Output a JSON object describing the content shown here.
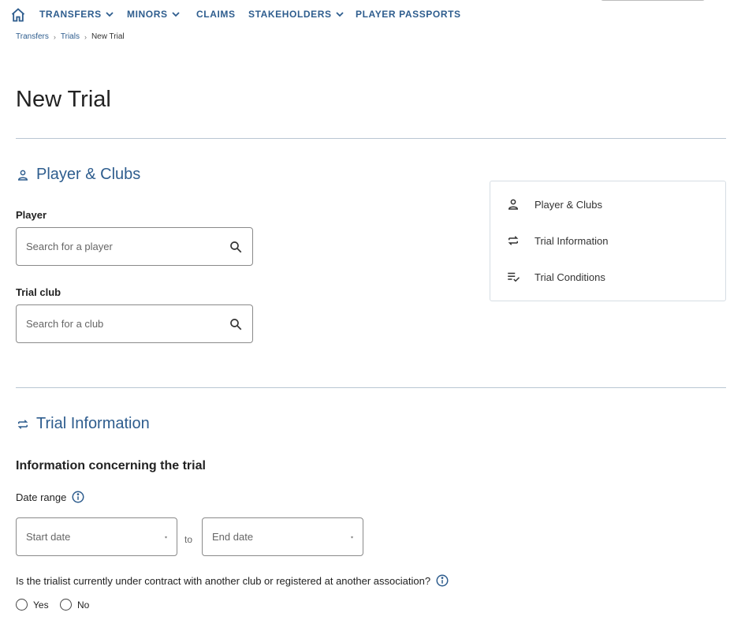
{
  "nav": {
    "items": [
      {
        "label": "TRANSFERS",
        "dropdown": true
      },
      {
        "label": "MINORS",
        "dropdown": true
      },
      {
        "label": "CLAIMS",
        "dropdown": false
      },
      {
        "label": "STAKEHOLDERS",
        "dropdown": true
      },
      {
        "label": "PLAYER PASSPORTS",
        "dropdown": false
      }
    ],
    "accent_color": "#2e5d8e"
  },
  "breadcrumb": [
    "Transfers",
    "Trials",
    "New Trial"
  ],
  "page_title": "New Trial",
  "section_player": {
    "title": "Player & Clubs",
    "icon": "person-icon",
    "player_label": "Player",
    "player_placeholder": "Search for a player",
    "club_label": "Trial club",
    "club_placeholder": "Search for a club"
  },
  "toc": [
    {
      "label": "Player & Clubs",
      "icon": "person-icon"
    },
    {
      "label": "Trial Information",
      "icon": "swap-icon"
    },
    {
      "label": "Trial Conditions",
      "icon": "checklist-icon"
    }
  ],
  "section_trial": {
    "title": "Trial Information",
    "icon": "swap-icon",
    "subheading": "Information concerning the trial",
    "date_range_label": "Date range",
    "start_placeholder": "Start date",
    "end_placeholder": "End date",
    "to_label": "to",
    "question": "Is the trialist currently under contract with another club or registered at another association?",
    "options": [
      "Yes",
      "No"
    ]
  }
}
